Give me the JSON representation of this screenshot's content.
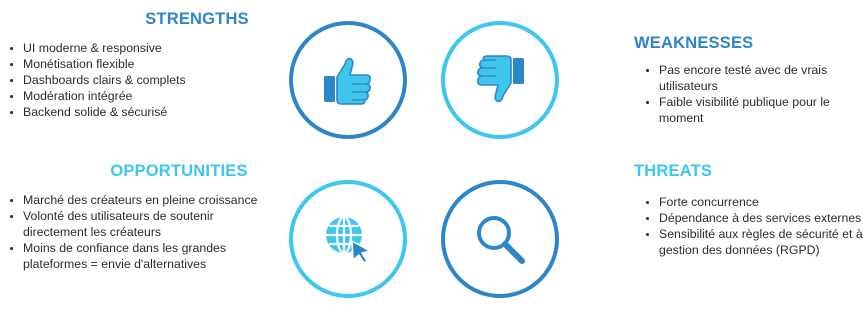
{
  "colors": {
    "dark_blue": "#2d86c7",
    "light_blue": "#3fc6ec",
    "text": "#2b2b2b"
  },
  "strengths": {
    "title": "STRENGTHS",
    "icon": "thumbs-up-icon",
    "items": [
      "UI moderne & responsive",
      "Monétisation flexible",
      "Dashboards clairs & complets",
      "Modération intégrée",
      "Backend solide & sécurisé"
    ]
  },
  "weaknesses": {
    "title": "WEAKNESSES",
    "icon": "thumbs-down-icon",
    "items": [
      "Pas encore testé avec de vrais utilisateurs",
      "Faible visibilité publique pour le moment"
    ]
  },
  "opportunities": {
    "title": "OPPORTUNITIES",
    "icon": "globe-cursor-icon",
    "items": [
      "Marché des créateurs en pleine croissance",
      "Volonté des utilisateurs de soutenir directement les créateurs",
      "Moins de confiance dans les grandes plateformes = envie d'alternatives"
    ]
  },
  "threats": {
    "title": "THREATS",
    "icon": "magnifier-icon",
    "items": [
      "Forte concurrence",
      "Dépendance à des services externes",
      "Sensibilité aux règles de sécurité et à la gestion des données (RGPD)"
    ]
  }
}
